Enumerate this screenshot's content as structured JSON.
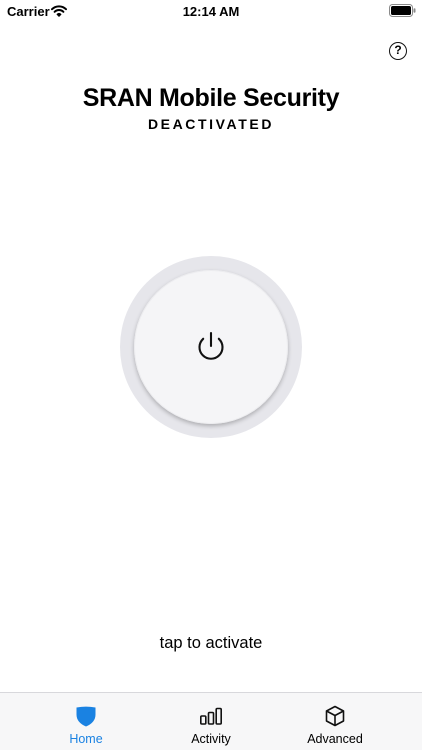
{
  "status_bar": {
    "carrier": "Carrier",
    "time": "12:14 AM"
  },
  "header": {
    "help_icon_glyph": "?",
    "title": "SRAN Mobile Security",
    "subtitle": "DEACTIVATED"
  },
  "main": {
    "power_icon": "power-icon",
    "hint": "tap to activate"
  },
  "tabs": [
    {
      "label": "Home",
      "icon": "shield-icon",
      "active": true
    },
    {
      "label": "Activity",
      "icon": "bar-chart-icon",
      "active": false
    },
    {
      "label": "Advanced",
      "icon": "cube-icon",
      "active": false
    }
  ],
  "colors": {
    "accent": "#1a82e2",
    "power_ring": "#e6e6eb",
    "power_face": "#f5f5f7"
  }
}
